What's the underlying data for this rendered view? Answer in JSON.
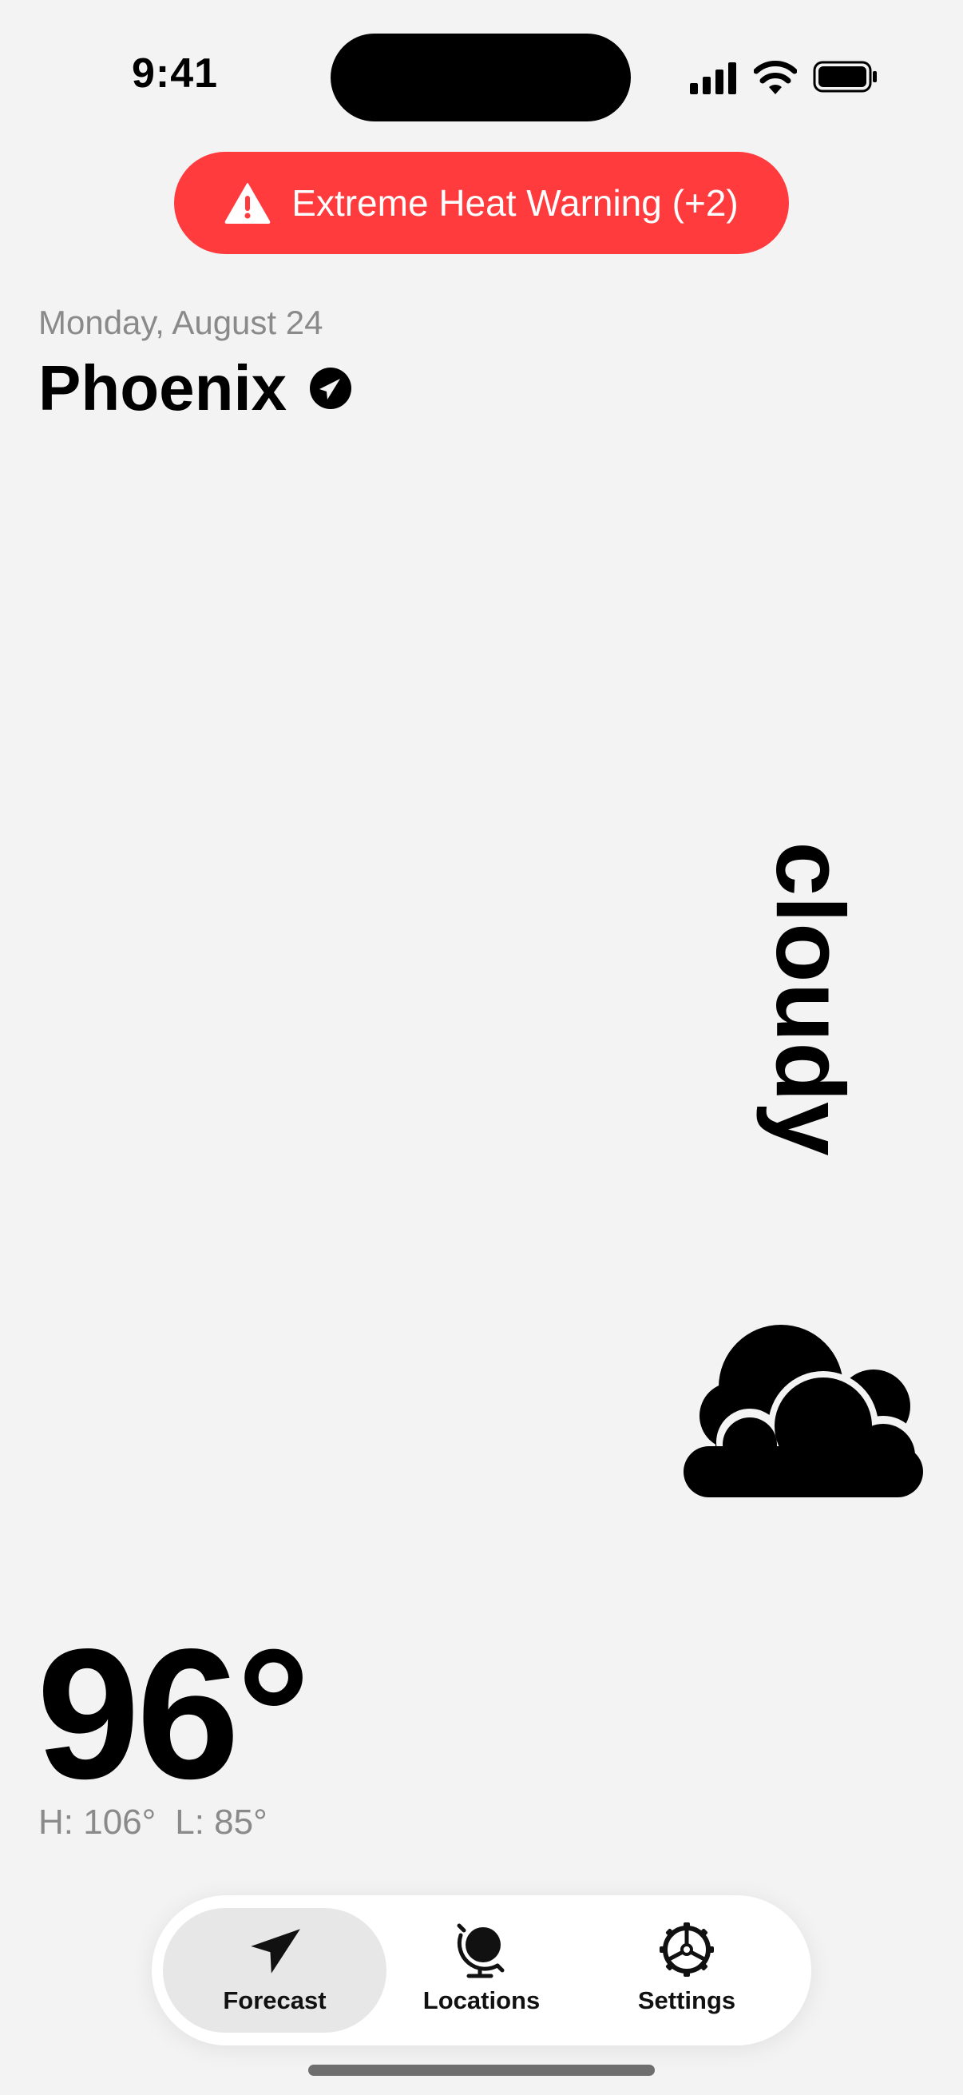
{
  "status_bar": {
    "time": "9:41",
    "icons": [
      "signal-icon",
      "wifi-icon",
      "battery-icon"
    ]
  },
  "alert": {
    "text": "Extreme Heat Warning (+2)",
    "icon": "warning-icon",
    "color": "#ff3b3e"
  },
  "header": {
    "date": "Monday, August 24",
    "city": "Phoenix",
    "icon": "location-arrow-icon"
  },
  "weather": {
    "condition": "cloudy",
    "icon": "cloud-icon",
    "temperature": "96°",
    "high": "H: 106°",
    "low": "L: 85°"
  },
  "tabs": [
    {
      "label": "Forecast",
      "icon": "navigation-arrow-icon",
      "active": true
    },
    {
      "label": "Locations",
      "icon": "globe-icon",
      "active": false
    },
    {
      "label": "Settings",
      "icon": "gear-icon",
      "active": false
    }
  ]
}
